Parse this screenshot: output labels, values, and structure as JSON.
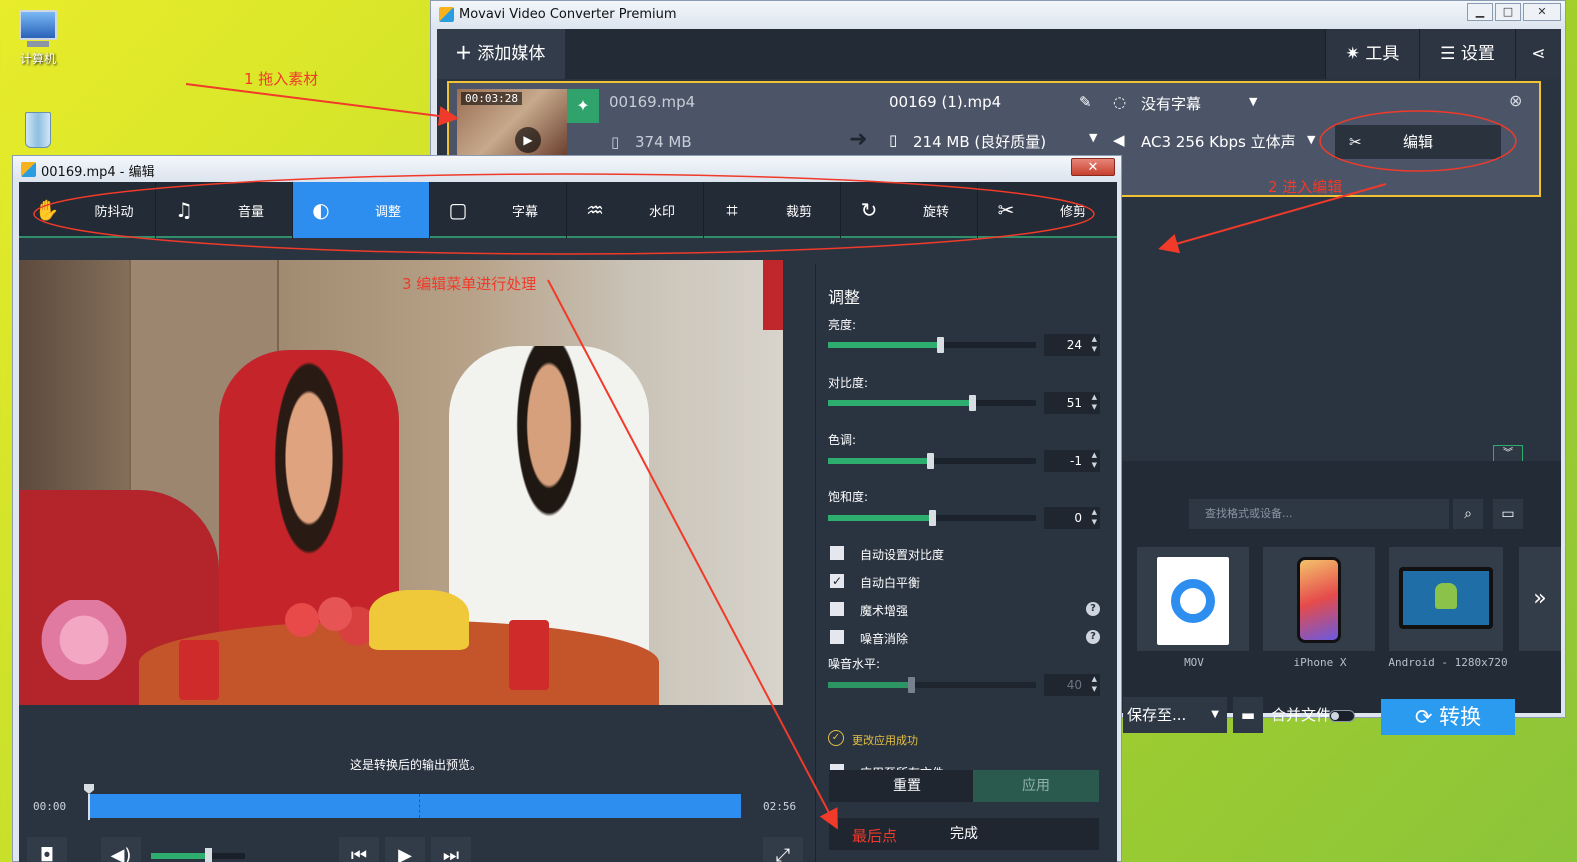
{
  "desktop": {
    "icons": [
      {
        "label": "计算机"
      },
      {
        "label": ""
      }
    ]
  },
  "annotations": {
    "step1": "1 拖入素材",
    "step2": "2 进入编辑",
    "step3": "3 编辑菜单进行处理",
    "final": "最后点"
  },
  "main_window": {
    "title": "Movavi Video Converter Premium",
    "add_media": "添加媒体",
    "tools": "工具",
    "settings": "设置",
    "file": {
      "duration": "00:03:28",
      "source_name": "00169.mp4",
      "source_size": "374 MB",
      "output_name": "00169 (1).mp4",
      "output_size": "214 MB (良好质量)",
      "subtitle": "没有字幕",
      "audio": "AC3 256 Kbps 立体声",
      "edit_label": "编辑"
    },
    "format_search_placeholder": "查找格式或设备...",
    "formats": [
      {
        "label": "MOV"
      },
      {
        "label": "iPhone X"
      },
      {
        "label": "Android - 1280x720"
      }
    ],
    "save_to": "保存至...",
    "merge_files": "合并文件",
    "convert": "转换"
  },
  "edit_window": {
    "title": "00169.mp4 - 编辑",
    "tabs": [
      {
        "label": "防抖动",
        "icon": "stabilize-icon"
      },
      {
        "label": "音量",
        "icon": "music-note-icon"
      },
      {
        "label": "调整",
        "icon": "adjust-icon"
      },
      {
        "label": "字幕",
        "icon": "subtitle-icon"
      },
      {
        "label": "水印",
        "icon": "watermark-icon"
      },
      {
        "label": "裁剪",
        "icon": "crop-icon"
      },
      {
        "label": "旋转",
        "icon": "rotate-icon"
      },
      {
        "label": "修剪",
        "icon": "scissors-icon"
      }
    ],
    "preview_note": "这是转换后的输出预览。",
    "time_start": "00:00",
    "time_end": "02:56",
    "panel": {
      "title": "调整",
      "sliders": [
        {
          "label": "亮度:",
          "value": "24",
          "fraction": 0.54
        },
        {
          "label": "对比度:",
          "value": "51",
          "fraction": 0.69
        },
        {
          "label": "色调:",
          "value": "-1",
          "fraction": 0.49
        },
        {
          "label": "饱和度:",
          "value": "0",
          "fraction": 0.5
        }
      ],
      "checkboxes": [
        {
          "label": "自动设置对比度",
          "checked": false
        },
        {
          "label": "自动白平衡",
          "checked": true
        },
        {
          "label": "魔术增强",
          "checked": false
        },
        {
          "label": "噪音消除",
          "checked": false
        }
      ],
      "noise_level": {
        "label": "噪音水平:",
        "value": "40",
        "fraction": 0.4
      },
      "status": "更改应用成功",
      "apply_all": "应用至所有文件",
      "reset": "重置",
      "apply": "应用",
      "done": "完成"
    }
  },
  "colors": {
    "accent_blue": "#2e8ef0",
    "accent_green": "#2eae6e",
    "annotation_red": "#f03a2a",
    "panel_bg": "#2a3340"
  }
}
